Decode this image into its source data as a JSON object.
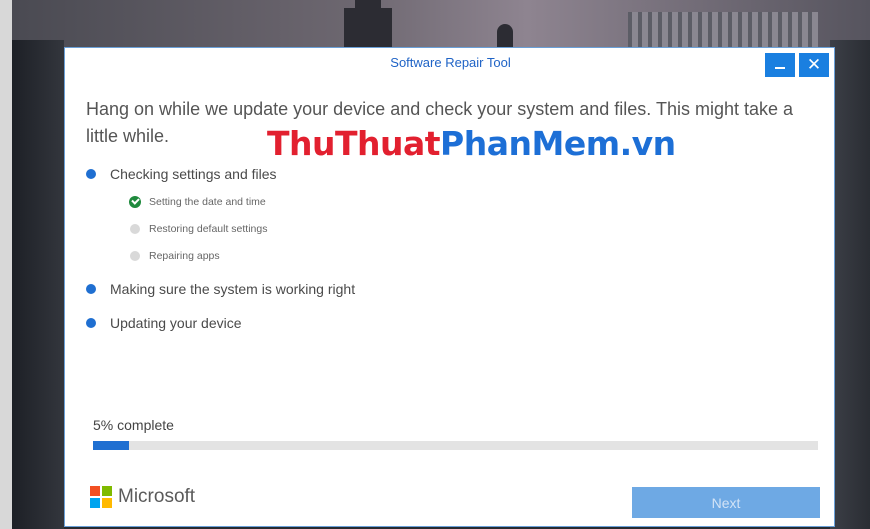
{
  "window": {
    "title": "Software Repair Tool",
    "minimize_icon": "minimize-icon",
    "close_glyph": "✕"
  },
  "headline": "Hang on while we update your device and check your system and files. This might take a little while.",
  "watermark": {
    "part1": "ThuThuat",
    "part2": "PhanMem.vn",
    "colors": {
      "part1": "#e2202f",
      "part2": "#1d6fd6"
    }
  },
  "steps": [
    {
      "label": "Checking settings and files",
      "substeps": [
        {
          "label": "Setting the date and time",
          "status": "done",
          "icon": "check-circle-icon"
        },
        {
          "label": "Restoring default settings",
          "status": "pending",
          "icon": "pending-dot-icon"
        },
        {
          "label": "Repairing apps",
          "status": "pending",
          "icon": "pending-dot-icon"
        }
      ]
    },
    {
      "label": "Making sure the system is working right",
      "substeps": []
    },
    {
      "label": "Updating your device",
      "substeps": []
    }
  ],
  "progress": {
    "label": "5% complete",
    "percent": 5
  },
  "brand": {
    "name": "Microsoft",
    "logo_colors": [
      "#f25022",
      "#7fba00",
      "#00a4ef",
      "#ffb900"
    ]
  },
  "buttons": {
    "next_label": "Next",
    "next_enabled": false
  },
  "colors": {
    "accent": "#1f6fd1",
    "title": "#1f63c6",
    "success": "#1f8a3d",
    "pending": "#d9d9d9"
  }
}
